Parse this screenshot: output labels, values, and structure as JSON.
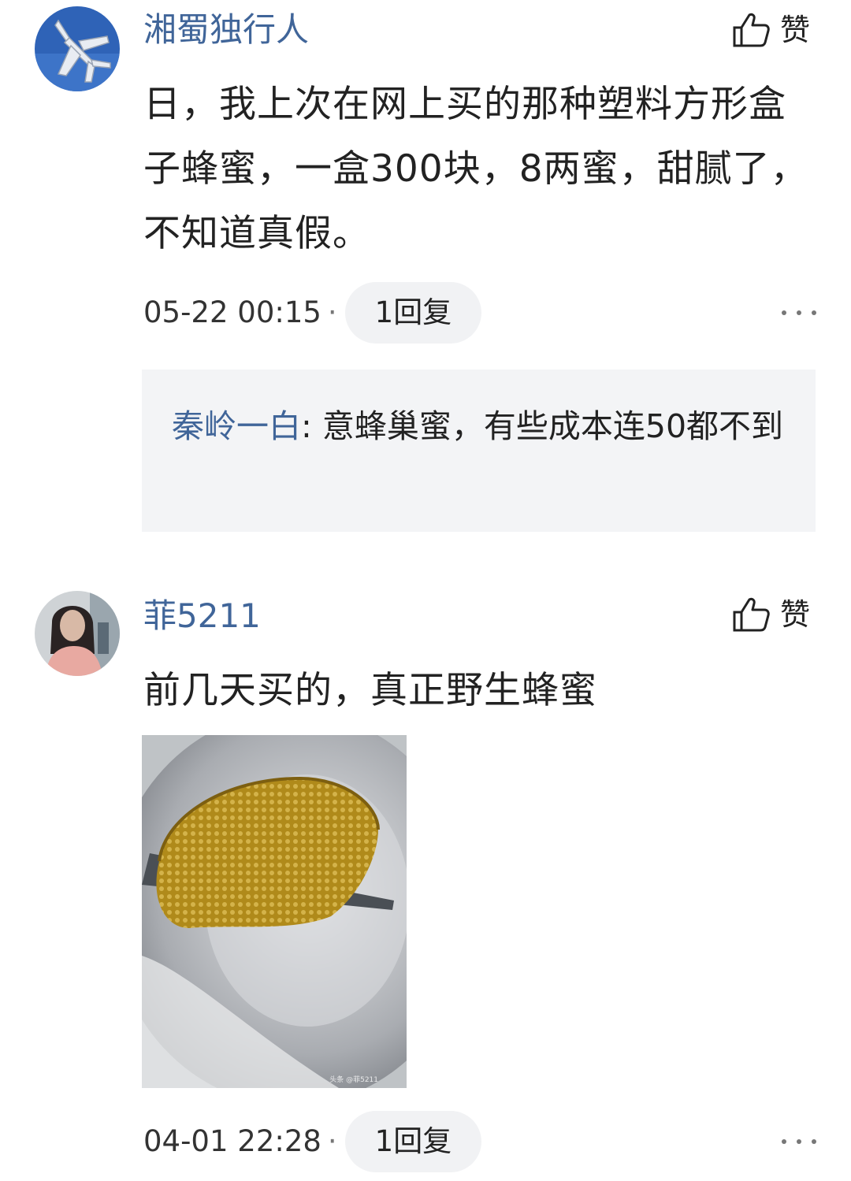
{
  "comments": [
    {
      "author": "湘蜀独行人",
      "like_label": "赞",
      "text": "日，我上次在网上买的那种塑料方形盒子蜂蜜，一盒300块，8两蜜，甜腻了，不知道真假。",
      "time": "05-22 00:15",
      "separator": "·",
      "reply_count": "1回复",
      "reply": {
        "name": "秦岭一白",
        "colon": ":",
        "text": " 意蜂巢蜜，有些成本连50都不到"
      }
    },
    {
      "author": "菲5211",
      "like_label": "赞",
      "text": "前几天买的，真正野生蜂蜜",
      "image": "photo of wild honeycomb on a knife",
      "time": "04-01 22:28",
      "separator": "·",
      "reply_count": "1回复"
    }
  ],
  "icons": {
    "like": "thumbs-up-icon",
    "more": "more-dots-icon"
  },
  "colors": {
    "author": "#406599",
    "reply_bg": "#f3f4f6",
    "pill_bg": "#f1f2f4"
  }
}
